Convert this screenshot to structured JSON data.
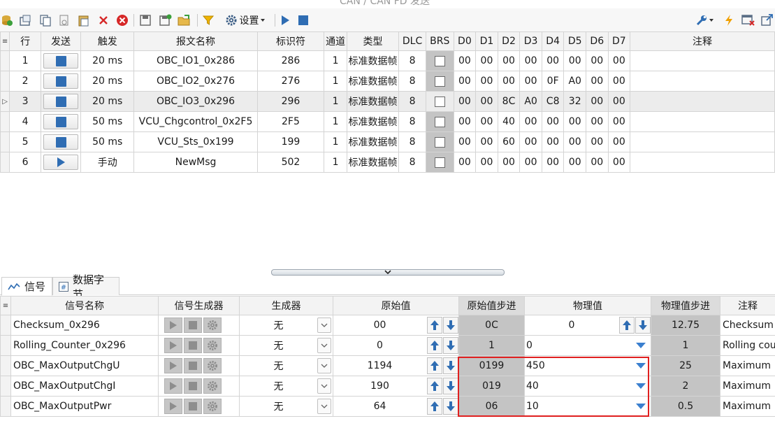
{
  "window_title": "CAN / CAN FD 发送",
  "toolbar": {
    "settings_label": "设置"
  },
  "frames": {
    "headers": [
      "行",
      "发送",
      "触发",
      "报文名称",
      "标识符",
      "通道",
      "类型",
      "DLC",
      "BRS",
      "D0",
      "D1",
      "D2",
      "D3",
      "D4",
      "D5",
      "D6",
      "D7",
      "注释"
    ],
    "rows": [
      {
        "row": "1",
        "send": "stop",
        "trigger": "20 ms",
        "name": "OBC_IO1_0x286",
        "id": "286",
        "ch": "1",
        "type": "标准数据帧",
        "dlc": "8",
        "d": [
          "00",
          "00",
          "00",
          "00",
          "00",
          "00",
          "00",
          "00"
        ]
      },
      {
        "row": "2",
        "send": "stop",
        "trigger": "20 ms",
        "name": "OBC_IO2_0x276",
        "id": "276",
        "ch": "1",
        "type": "标准数据帧",
        "dlc": "8",
        "d": [
          "00",
          "00",
          "00",
          "00",
          "0F",
          "A0",
          "00",
          "00"
        ]
      },
      {
        "row": "3",
        "send": "stop",
        "trigger": "20 ms",
        "name": "OBC_IO3_0x296",
        "id": "296",
        "ch": "1",
        "type": "标准数据帧",
        "dlc": "8",
        "d": [
          "00",
          "00",
          "8C",
          "A0",
          "C8",
          "32",
          "00",
          "00"
        ]
      },
      {
        "row": "4",
        "send": "stop",
        "trigger": "50 ms",
        "name": "VCU_Chgcontrol_0x2F5",
        "id": "2F5",
        "ch": "1",
        "type": "标准数据帧",
        "dlc": "8",
        "d": [
          "00",
          "00",
          "40",
          "00",
          "00",
          "00",
          "00",
          "00"
        ]
      },
      {
        "row": "5",
        "send": "stop",
        "trigger": "50 ms",
        "name": "VCU_Sts_0x199",
        "id": "199",
        "ch": "1",
        "type": "标准数据帧",
        "dlc": "8",
        "d": [
          "00",
          "00",
          "60",
          "00",
          "00",
          "00",
          "00",
          "00"
        ]
      },
      {
        "row": "6",
        "send": "play",
        "trigger": "手动",
        "name": "NewMsg",
        "id": "502",
        "ch": "1",
        "type": "标准数据帧",
        "dlc": "8",
        "d": [
          "00",
          "00",
          "00",
          "00",
          "00",
          "00",
          "00",
          "00"
        ]
      }
    ]
  },
  "tabs": [
    {
      "label": "信号"
    },
    {
      "label": "数据字节"
    }
  ],
  "signals": {
    "headers": [
      "信号名称",
      "信号生成器",
      "生成器",
      "原始值",
      "原始值步进",
      "物理值",
      "物理值步进",
      "注释"
    ],
    "rows": [
      {
        "name": "Checksum_0x296",
        "generator": "无",
        "raw": "00",
        "raw_step": "0C",
        "phys": "0",
        "phys_step": "12.75",
        "comment": "Checksum"
      },
      {
        "name": "Rolling_Counter_0x296",
        "generator": "无",
        "raw": "0",
        "raw_step": "1",
        "phys": "0",
        "phys_step": "1",
        "comment": "Rolling cour"
      },
      {
        "name": "OBC_MaxOutputChgU",
        "generator": "无",
        "raw": "1194",
        "raw_step": "0199",
        "phys": "450",
        "phys_step": "25",
        "comment": "Maximum"
      },
      {
        "name": "OBC_MaxOutputChgI",
        "generator": "无",
        "raw": "190",
        "raw_step": "019",
        "phys": "40",
        "phys_step": "2",
        "comment": "Maximum"
      },
      {
        "name": "OBC_MaxOutputPwr",
        "generator": "无",
        "raw": "64",
        "raw_step": "06",
        "phys": "10",
        "phys_step": "0.5",
        "comment": "Maximum"
      }
    ]
  },
  "colors": {
    "accent_blue": "#2f6db3",
    "highlight_red": "#e02020",
    "grey_cell": "#c4c4c4"
  }
}
